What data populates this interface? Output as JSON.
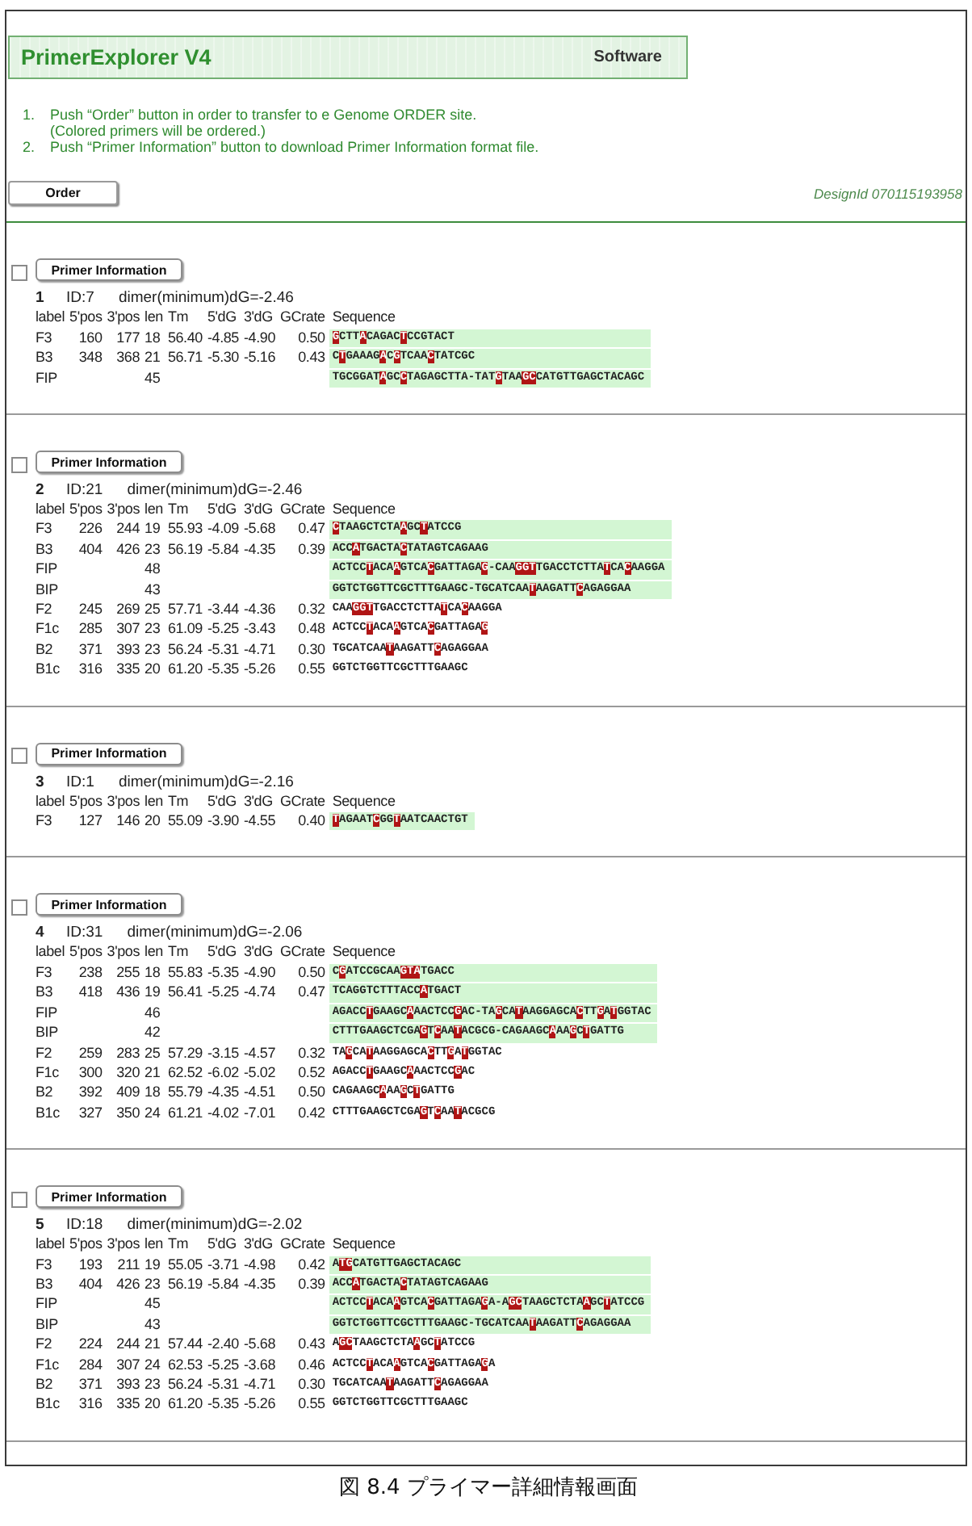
{
  "header": {
    "title": "PrimerExplorer V4",
    "subtitle": "Software"
  },
  "instructions": [
    {
      "number": "1.",
      "text": "Push “Order” button in order to transfer to e Genome ORDER site.",
      "note": "(Colored primers will be ordered.)"
    },
    {
      "number": "2.",
      "text": "Push “Primer Information” button to download Primer Information format file."
    }
  ],
  "order_button": "Order",
  "design_id": "DesignId 070115193958",
  "candidates": [
    {
      "checked": false,
      "button": "Primer Information",
      "number": "1",
      "id": "ID:7",
      "dimer": "dimer(minimum)dG=-2.46",
      "columns": [
        "label",
        "5'pos",
        "3'pos",
        "len",
        "Tm",
        "5'dG",
        "3'dG",
        "GCrate",
        "Sequence"
      ],
      "rows": [
        {
          "label": "F3",
          "pos5": "160",
          "pos3": "177",
          "len": "18",
          "tm": "56.40",
          "dg5": "-4.85",
          "dg3": "-4.90",
          "gc": "0.50",
          "sequence": "**G**CTT**A**CAGAC**T**CCGTACT",
          "colored": true
        },
        {
          "label": "B3",
          "pos5": "348",
          "pos3": "368",
          "len": "21",
          "tm": "56.71",
          "dg5": "-5.30",
          "dg3": "-5.16",
          "gc": "0.43",
          "sequence": "C**T**GAAAG**A**C**G**TCAA**C**TATCGC",
          "colored": true
        },
        {
          "label": "FIP",
          "len": "45",
          "sequence": "TGCGGAT**A**GC**C**TAGAGCTTA-TAT**G**TAA**GC**CATGTTGAGCTACAGC",
          "colored": true
        }
      ]
    },
    {
      "checked": false,
      "button": "Primer Information",
      "number": "2",
      "id": "ID:21",
      "dimer": "dimer(minimum)dG=-2.46",
      "columns": [
        "label",
        "5'pos",
        "3'pos",
        "len",
        "Tm",
        "5'dG",
        "3'dG",
        "GCrate",
        "Sequence"
      ],
      "rows": [
        {
          "label": "F3",
          "pos5": "226",
          "pos3": "244",
          "len": "19",
          "tm": "55.93",
          "dg5": "-4.09",
          "dg3": "-5.68",
          "gc": "0.47",
          "sequence": "**C**TAAGCTCTA**A**GC**T**ATCCG",
          "colored": true
        },
        {
          "label": "B3",
          "pos5": "404",
          "pos3": "426",
          "len": "23",
          "tm": "56.19",
          "dg5": "-5.84",
          "dg3": "-4.35",
          "gc": "0.39",
          "sequence": "ACC**A**TGACTA**C**TATAGTCAGAAG",
          "colored": true
        },
        {
          "label": "FIP",
          "len": "48",
          "sequence": "ACTCC**T**ACA**A**GTCA**C**GATTAGA**G**-CAA**GGT**TGACCTCTTA**T**CA**C**AAGGA",
          "colored": true
        },
        {
          "label": "BIP",
          "len": "43",
          "sequence": "GGTCTGGTTCGCTTTGAAGC-TGCATCAA**T**AAGATT**C**AGAGGAA",
          "colored": true
        },
        {
          "label": "F2",
          "pos5": "245",
          "pos3": "269",
          "len": "25",
          "tm": "57.71",
          "dg5": "-3.44",
          "dg3": "-4.36",
          "gc": "0.32",
          "sequence": "CAA**GGT**TGACCTCTTA**T**CA**C**AAGGA",
          "colored": false
        },
        {
          "label": "F1c",
          "pos5": "285",
          "pos3": "307",
          "len": "23",
          "tm": "61.09",
          "dg5": "-5.25",
          "dg3": "-3.43",
          "gc": "0.48",
          "sequence": "ACTCC**T**ACA**A**GTCA**C**GATTAGA**G**",
          "colored": false
        },
        {
          "label": "B2",
          "pos5": "371",
          "pos3": "393",
          "len": "23",
          "tm": "56.24",
          "dg5": "-5.31",
          "dg3": "-4.71",
          "gc": "0.30",
          "sequence": "TGCATCAA**T**AAGATT**C**AGAGGAA",
          "colored": false
        },
        {
          "label": "B1c",
          "pos5": "316",
          "pos3": "335",
          "len": "20",
          "tm": "61.20",
          "dg5": "-5.35",
          "dg3": "-5.26",
          "gc": "0.55",
          "sequence": "GGTCTGGTTCGCTTTGAAGC",
          "colored": false
        }
      ]
    },
    {
      "checked": false,
      "button": "Primer Information",
      "number": "3",
      "id": "ID:1",
      "dimer": "dimer(minimum)dG=-2.16",
      "columns": [
        "label",
        "5'pos",
        "3'pos",
        "len",
        "Tm",
        "5'dG",
        "3'dG",
        "GCrate",
        "Sequence"
      ],
      "rows": [
        {
          "label": "F3",
          "pos5": "127",
          "pos3": "146",
          "len": "20",
          "tm": "55.09",
          "dg5": "-3.90",
          "dg3": "-4.55",
          "gc": "0.40",
          "sequence": "**T**AGAAT**C**GG**T**AATCAACTGT",
          "colored": true
        }
      ]
    },
    {
      "checked": false,
      "button": "Primer Information",
      "number": "4",
      "id": "ID:31",
      "dimer": "dimer(minimum)dG=-2.06",
      "columns": [
        "label",
        "5'pos",
        "3'pos",
        "len",
        "Tm",
        "5'dG",
        "3'dG",
        "GCrate",
        "Sequence"
      ],
      "rows": [
        {
          "label": "F3",
          "pos5": "238",
          "pos3": "255",
          "len": "18",
          "tm": "55.83",
          "dg5": "-5.35",
          "dg3": "-4.90",
          "gc": "0.50",
          "sequence": "C**G**ATCCGCAA**GTA**TGACC",
          "colored": true
        },
        {
          "label": "B3",
          "pos5": "418",
          "pos3": "436",
          "len": "19",
          "tm": "56.41",
          "dg5": "-5.25",
          "dg3": "-4.74",
          "gc": "0.47",
          "sequence": "TCAGGTCTTTACC**A**TGACT",
          "colored": true
        },
        {
          "label": "FIP",
          "len": "46",
          "sequence": "AGACC**T**GAAGC**A**AACTCC**G**AC-TA**G**CA**T**AAGGAGCA**C**TT**G**A**T**GGTAC",
          "colored": true
        },
        {
          "label": "BIP",
          "len": "42",
          "sequence": "CTTTGAAGCTCGA**G**T**C**AA**T**ACGCG-CAGAAGC**A**AA**G**C**T**GATTG",
          "colored": true
        },
        {
          "label": "F2",
          "pos5": "259",
          "pos3": "283",
          "len": "25",
          "tm": "57.29",
          "dg5": "-3.15",
          "dg3": "-4.57",
          "gc": "0.32",
          "sequence": "TA**G**CA**T**AAGGAGCA**C**TT**G**A**T**GGTAC",
          "colored": false
        },
        {
          "label": "F1c",
          "pos5": "300",
          "pos3": "320",
          "len": "21",
          "tm": "62.52",
          "dg5": "-6.02",
          "dg3": "-5.02",
          "gc": "0.52",
          "sequence": "AGACC**T**GAAGC**A**AACTCC**G**AC",
          "colored": false
        },
        {
          "label": "B2",
          "pos5": "392",
          "pos3": "409",
          "len": "18",
          "tm": "55.79",
          "dg5": "-4.35",
          "dg3": "-4.51",
          "gc": "0.50",
          "sequence": "CAGAAGC**A**AA**G**C**T**GATTG",
          "colored": false
        },
        {
          "label": "B1c",
          "pos5": "327",
          "pos3": "350",
          "len": "24",
          "tm": "61.21",
          "dg5": "-4.02",
          "dg3": "-7.01",
          "gc": "0.42",
          "sequence": "CTTTGAAGCTCGA**G**T**C**AA**T**ACGCG",
          "colored": false
        }
      ]
    },
    {
      "checked": false,
      "button": "Primer Information",
      "number": "5",
      "id": "ID:18",
      "dimer": "dimer(minimum)dG=-2.02",
      "columns": [
        "label",
        "5'pos",
        "3'pos",
        "len",
        "Tm",
        "5'dG",
        "3'dG",
        "GCrate",
        "Sequence"
      ],
      "rows": [
        {
          "label": "F3",
          "pos5": "193",
          "pos3": "211",
          "len": "19",
          "tm": "55.05",
          "dg5": "-3.71",
          "dg3": "-4.98",
          "gc": "0.42",
          "sequence": "A**TG**CATGTTGAGCTACAGC",
          "colored": true
        },
        {
          "label": "B3",
          "pos5": "404",
          "pos3": "426",
          "len": "23",
          "tm": "56.19",
          "dg5": "-5.84",
          "dg3": "-4.35",
          "gc": "0.39",
          "sequence": "ACC**A**TGACTA**C**TATAGTCAGAAG",
          "colored": true
        },
        {
          "label": "FIP",
          "len": "45",
          "sequence": "ACTCC**T**ACA**A**GTCA**C**GATTAGA**G**A-A**GC**TAAGCTCTA**A**GC**T**ATCCG",
          "colored": true
        },
        {
          "label": "BIP",
          "len": "43",
          "sequence": "GGTCTGGTTCGCTTTGAAGC-TGCATCAA**T**AAGATT**C**AGAGGAA",
          "colored": true
        },
        {
          "label": "F2",
          "pos5": "224",
          "pos3": "244",
          "len": "21",
          "tm": "57.44",
          "dg5": "-2.40",
          "dg3": "-5.68",
          "gc": "0.43",
          "sequence": "A**GC**TAAGCTCTA**A**GC**T**ATCCG",
          "colored": false
        },
        {
          "label": "F1c",
          "pos5": "284",
          "pos3": "307",
          "len": "24",
          "tm": "62.53",
          "dg5": "-5.25",
          "dg3": "-3.68",
          "gc": "0.46",
          "sequence": "ACTCC**T**ACA**A**GTCA**C**GATTAGA**G**A",
          "colored": false
        },
        {
          "label": "B2",
          "pos5": "371",
          "pos3": "393",
          "len": "23",
          "tm": "56.24",
          "dg5": "-5.31",
          "dg3": "-4.71",
          "gc": "0.30",
          "sequence": "TGCATCAA**T**AAGATT**C**AGAGGAA",
          "colored": false
        },
        {
          "label": "B1c",
          "pos5": "316",
          "pos3": "335",
          "len": "20",
          "tm": "61.20",
          "dg5": "-5.35",
          "dg3": "-5.26",
          "gc": "0.55",
          "sequence": "GGTCTGGTTCGCTTTGAAGC",
          "colored": false
        }
      ]
    }
  ],
  "caption": "図 8.4 プライマー詳細情報画面"
}
